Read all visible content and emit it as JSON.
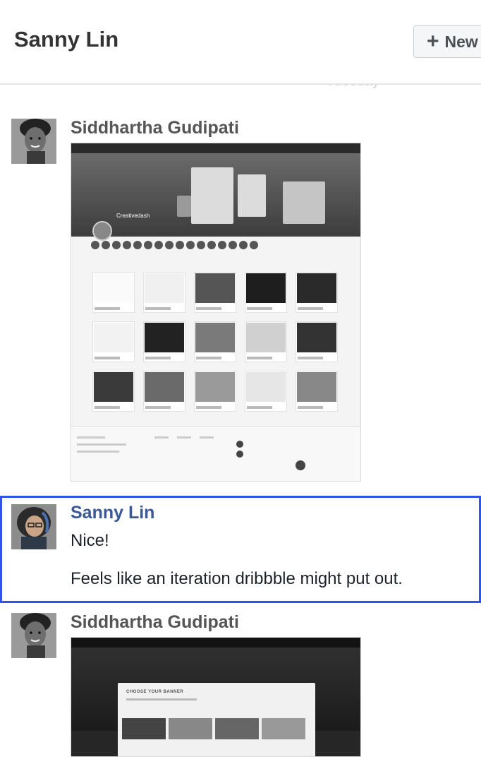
{
  "header": {
    "title": "Sanny Lin",
    "new_button_label": "New",
    "date_separator": "Tuesday"
  },
  "messages": [
    {
      "sender": "Siddhartha Gudipati",
      "attachment": {
        "type": "image",
        "hero_title": "Creativedash"
      }
    },
    {
      "sender": "Sanny Lin",
      "lines": [
        "Nice!",
        "Feels like an iteration dribbble might put out."
      ]
    },
    {
      "sender": "Siddhartha Gudipati",
      "attachment": {
        "type": "image",
        "modal_title": "CHOOSE YOUR BANNER"
      }
    }
  ],
  "colors": {
    "selection_outline": "#2f54eb",
    "own_sender": "#3b5998",
    "other_sender": "#555555"
  }
}
